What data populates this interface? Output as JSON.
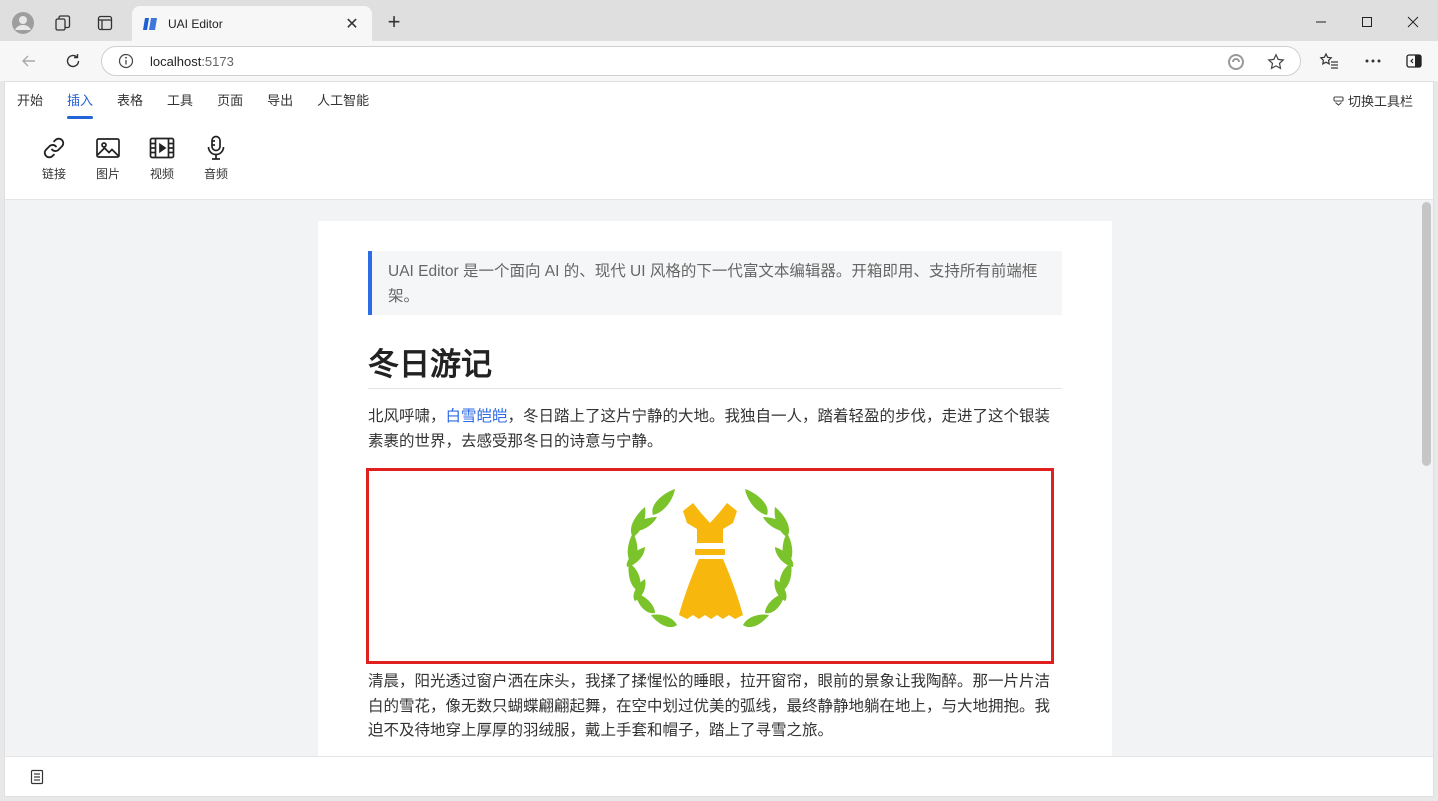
{
  "browser": {
    "tab_title": "UAI Editor",
    "url_host": "localhost",
    "url_port": ":5173"
  },
  "editor": {
    "menu_tabs": [
      "开始",
      "插入",
      "表格",
      "工具",
      "页面",
      "导出",
      "人工智能"
    ],
    "active_tab": "插入",
    "toggle_toolbar_label": "切换工具栏",
    "tools": [
      {
        "icon": "link-icon",
        "label": "链接"
      },
      {
        "icon": "image-icon",
        "label": "图片"
      },
      {
        "icon": "video-icon",
        "label": "视频"
      },
      {
        "icon": "audio-icon",
        "label": "音频"
      }
    ]
  },
  "document": {
    "quote": "UAI Editor 是一个面向 AI 的、现代 UI 风格的下一代富文本编辑器。开箱即用、支持所有前端框架。",
    "heading": "冬日游记",
    "para1_before": "北风呼啸，",
    "para1_link": "白雪皑皑",
    "para1_after": "，冬日踏上了这片宁静的大地。我独自一人，踏着轻盈的步伐，走进了这个银装素裹的世界，去感受那冬日的诗意与宁静。",
    "image": {
      "icon": "dress-laurel-icon"
    },
    "para2": "清晨，阳光透过窗户洒在床头，我揉了揉惺忪的睡眼，拉开窗帘，眼前的景象让我陶醉。那一片片洁白的雪花，像无数只蝴蝶翩翩起舞，在空中划过优美的弧线，最终静静地躺在地上，与大地拥抱。我迫不及待地穿上厚厚的羽绒服，戴上手套和帽子，踏上了寻雪之旅。"
  },
  "colors": {
    "accent": "#2463d8",
    "selection_border": "#e02020",
    "laurel": "#7ac32b",
    "dress": "#f7b70c"
  }
}
